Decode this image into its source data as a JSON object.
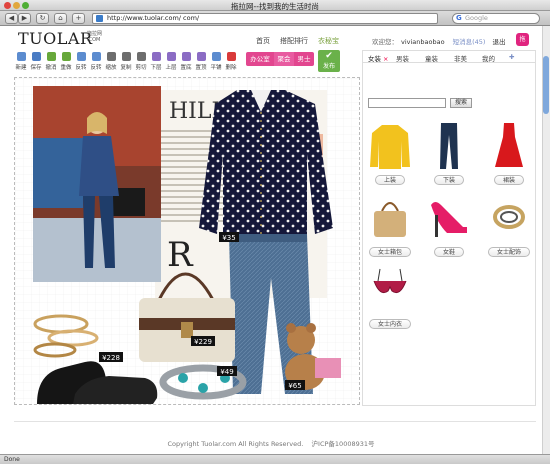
{
  "window": {
    "title": "拖拉网--找到我的生活时尚"
  },
  "browser": {
    "url": "http://www.tuolar.com/                    com/",
    "search_placeholder": "Google",
    "status": "Done"
  },
  "site": {
    "logo": "TUOLAR",
    "logo_sub_1": "拖拉网",
    "logo_sub_2": ".COM",
    "nav": {
      "home": "首页",
      "ranking": "搭配排行",
      "wizard": "衣秘宝"
    },
    "user": {
      "welcome": "欢迎您：",
      "name": "vivianbaobao",
      "messages": "短消息(45)",
      "logout": "退出"
    },
    "badge": "拖"
  },
  "toolbar": {
    "tools": [
      {
        "label": "新建",
        "icon": "new-icon",
        "color": "#5c8ccf"
      },
      {
        "label": "保存",
        "icon": "save-icon",
        "color": "#4a7cc4"
      },
      {
        "label": "撤消",
        "icon": "undo-icon",
        "color": "#67a83a"
      },
      {
        "label": "重做",
        "icon": "redo-icon",
        "color": "#67a83a"
      },
      {
        "label": "反转",
        "icon": "flip-h-icon",
        "color": "#5c8ccf"
      },
      {
        "label": "反转",
        "icon": "flip-v-icon",
        "color": "#5c8ccf"
      },
      {
        "label": "缩放",
        "icon": "zoom-icon",
        "color": "#6d6d6d"
      },
      {
        "label": "复制",
        "icon": "copy-icon",
        "color": "#6d6d6d"
      },
      {
        "label": "剪切",
        "icon": "cut-icon",
        "color": "#6d6d6d"
      },
      {
        "label": "下层",
        "icon": "layer-down-icon",
        "color": "#8b6cc4"
      },
      {
        "label": "上层",
        "icon": "layer-up-icon",
        "color": "#8b6cc4"
      },
      {
        "label": "置底",
        "icon": "to-bottom-icon",
        "color": "#8b6cc4"
      },
      {
        "label": "置顶",
        "icon": "to-top-icon",
        "color": "#8b6cc4"
      },
      {
        "label": "平铺",
        "icon": "tile-icon",
        "color": "#5c8ccf"
      },
      {
        "label": "删除",
        "icon": "delete-icon",
        "color": "#d93a3a"
      }
    ],
    "buttons": {
      "office": "办公室",
      "party": "聚会",
      "men": "男士"
    },
    "publish": "发布"
  },
  "canvas": {
    "prices": [
      "¥35",
      "¥228",
      "¥229",
      "¥49",
      "¥65"
    ],
    "magazine_text": "HILD IN"
  },
  "panel": {
    "tabs": [
      {
        "label": "女装",
        "active": true
      },
      {
        "label": "男装",
        "active": false
      },
      {
        "label": "童装",
        "active": false
      },
      {
        "label": "非美",
        "active": false
      },
      {
        "label": "我的",
        "active": false
      }
    ],
    "search_placeholder": "",
    "search_button": "搜索",
    "categories": [
      {
        "label": "上装",
        "icon": "sweater-icon"
      },
      {
        "label": "下装",
        "icon": "jeans-icon"
      },
      {
        "label": "裙装",
        "icon": "dress-icon"
      },
      {
        "label": "女士箱包",
        "icon": "handbag-icon"
      },
      {
        "label": "女鞋",
        "icon": "heels-icon"
      },
      {
        "label": "女士配饰",
        "icon": "ring-icon"
      },
      {
        "label": "女士内衣",
        "icon": "bra-icon"
      }
    ]
  },
  "footer": {
    "copyright": "Copyright  Tuolar.com All Rights Reserved.",
    "icp": "沪ICP备10008931号"
  }
}
